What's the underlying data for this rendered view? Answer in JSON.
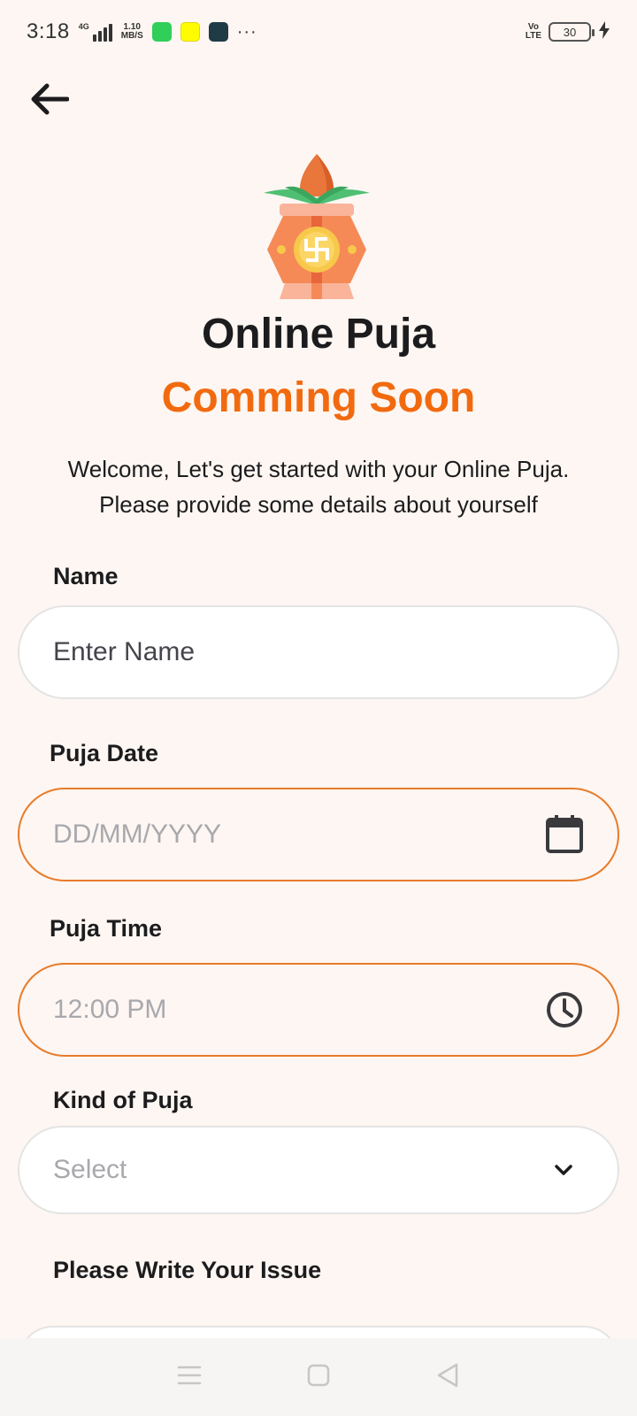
{
  "status": {
    "time": "3:18",
    "network": "4G",
    "speed_top": "1.10",
    "speed_bottom": "MB/S",
    "overflow": "···",
    "volte_top": "Vo",
    "volte_bottom": "LTE",
    "battery": "30"
  },
  "hero": {
    "title": "Online Puja",
    "subtitle": "Comming Soon",
    "intro_line1": "Welcome, Let's get started with your Online Puja.",
    "intro_line2": "Please provide some details about yourself"
  },
  "form": {
    "name": {
      "label": "Name",
      "value": "Enter Name"
    },
    "date": {
      "label": "Puja Date",
      "placeholder": "DD/MM/YYYY",
      "icon": "calendar-icon"
    },
    "time": {
      "label": "Puja Time",
      "placeholder": "12:00 PM",
      "icon": "clock-icon"
    },
    "kind": {
      "label": "Kind of Puja",
      "placeholder": "Select",
      "icon": "chevron-down-icon"
    },
    "issue": {
      "label": "Please Write Your Issue"
    }
  },
  "colors": {
    "accent": "#f26a0f",
    "border_active": "#e87b2a",
    "background": "#fdf6f2"
  }
}
